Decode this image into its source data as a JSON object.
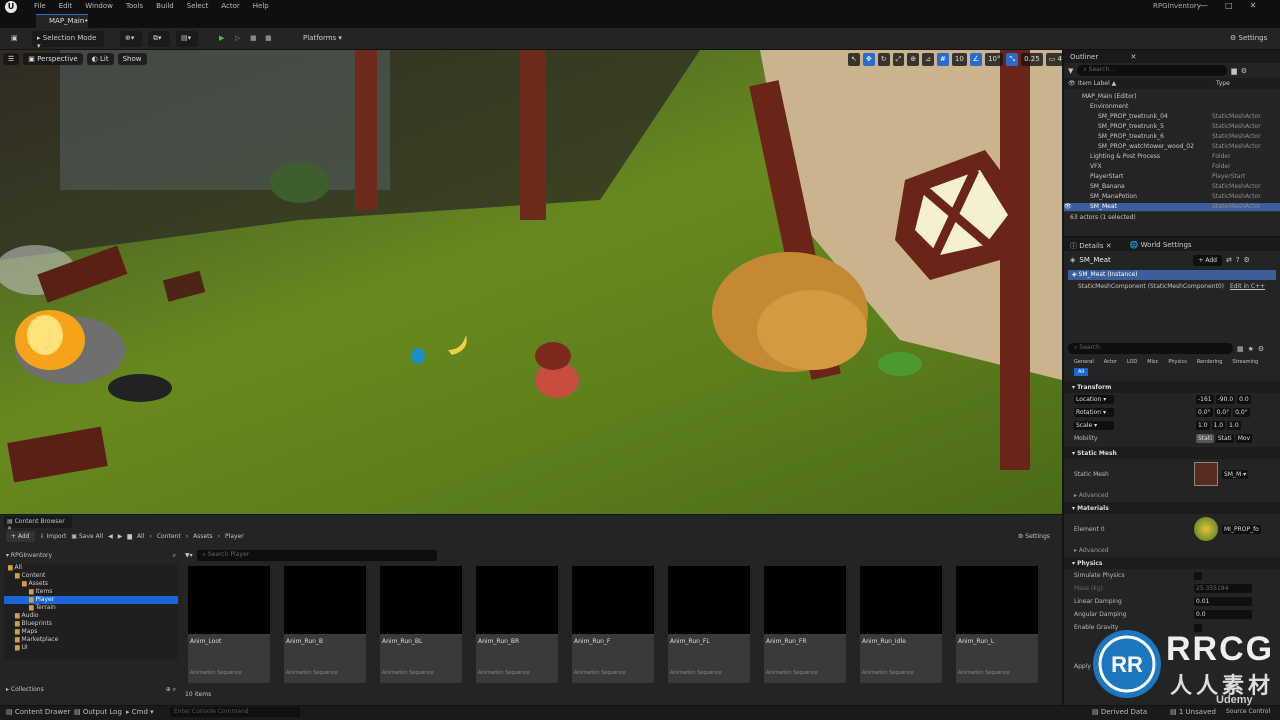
{
  "app": {
    "logo": "U",
    "menu": [
      "File",
      "Edit",
      "Window",
      "Tools",
      "Build",
      "Select",
      "Actor",
      "Help"
    ],
    "project_name": "RPGInventory",
    "window_controls": [
      "—",
      "□",
      "✕"
    ]
  },
  "tab": {
    "label": "MAP_Main•"
  },
  "toolbar": {
    "selection_mode": "Selection Mode",
    "platforms": "Platforms",
    "settings": "Settings"
  },
  "viewport": {
    "perspective": "Perspective",
    "lit": "Lit",
    "show": "Show",
    "grid_snap": "10",
    "rot_snap": "10°",
    "scale_snap": "0.25",
    "camera_speed": "4"
  },
  "outliner": {
    "title": "Outliner",
    "search_placeholder": "Search...",
    "col_label": "Item Label ▲",
    "col_type": "Type",
    "rows": [
      {
        "name": "MAP_Main (Editor)",
        "type": "",
        "indent": 1
      },
      {
        "name": "Environment",
        "type": "",
        "indent": 2
      },
      {
        "name": "SM_PROP_treetrunk_04",
        "type": "StaticMeshActor",
        "indent": 3
      },
      {
        "name": "SM_PROP_treetrunk_5",
        "type": "StaticMeshActor",
        "indent": 3
      },
      {
        "name": "SM_PROP_treetrunk_6",
        "type": "StaticMeshActor",
        "indent": 3
      },
      {
        "name": "SM_PROP_watchtower_wood_02",
        "type": "StaticMeshActor",
        "indent": 3
      },
      {
        "name": "Lighting & Post Process",
        "type": "Folder",
        "indent": 2
      },
      {
        "name": "VFX",
        "type": "Folder",
        "indent": 2
      },
      {
        "name": "PlayerStart",
        "type": "PlayerStart",
        "indent": 2
      },
      {
        "name": "SM_Banana",
        "type": "StaticMeshActor",
        "indent": 2
      },
      {
        "name": "SM_ManaPotion",
        "type": "StaticMeshActor",
        "indent": 2
      },
      {
        "name": "SM_Meat",
        "type": "StaticMeshActor",
        "indent": 2,
        "selected": true
      }
    ],
    "footer": "63 actors (1 selected)"
  },
  "details": {
    "tab_details": "Details",
    "tab_world": "World Settings",
    "actor": "SM_Meat",
    "add": "+ Add",
    "instance": "SM_Meat (Instance)",
    "component": "StaticMeshComponent (StaticMeshComponent0)",
    "edit_cpp": "Edit in C++",
    "search_placeholder": "Search",
    "filters": [
      "General",
      "Actor",
      "LOD",
      "Misc",
      "Physics",
      "Rendering",
      "Streaming",
      "All"
    ],
    "transform": "Transform",
    "location": "Location",
    "rotation": "Rotation",
    "scale": "Scale",
    "loc": [
      "-161",
      "-90.0",
      "0.0"
    ],
    "rot": [
      "0.0°",
      "0.0°",
      "0.0°"
    ],
    "scl": [
      "1.0",
      "1.0",
      "1.0"
    ],
    "mobility": "Mobility",
    "mob_opts": [
      "Stati",
      "Stati",
      "Mov"
    ],
    "static_mesh_sec": "Static Mesh",
    "static_mesh": "Static Mesh",
    "mesh_value": "SM_M ▾",
    "advanced": "Advanced",
    "materials": "Materials",
    "element0": "Element 0",
    "material_value": "MI_PROP_fo",
    "physics": "Physics",
    "sim_physics": "Simulate Physics",
    "mass": "Mass (kg)",
    "mass_val": "25.355194",
    "lin_damp": "Linear Damping",
    "lin_val": "0.01",
    "ang_damp": "Angular Damping",
    "ang_val": "0.0",
    "enable_grav": "Enable Gravity",
    "apply": "Apply"
  },
  "content_browser": {
    "tab": "Content Browser",
    "add": "+ Add",
    "import": "Import",
    "save_all": "Save All",
    "path": [
      "All",
      "Content",
      "Assets",
      "Player"
    ],
    "settings": "Settings",
    "project": "RPGInventory",
    "search_placeholder": "Search Player",
    "tree": [
      "All",
      "Content",
      "Assets",
      "Items",
      "Player",
      "Terrain",
      "Audio",
      "Blueprints",
      "Maps",
      "Marketplace",
      "UI"
    ],
    "collections": "Collections",
    "count": "10 items",
    "assets": [
      {
        "name": "Anim_Loot",
        "type": "Animation Sequence"
      },
      {
        "name": "Anim_Run_B",
        "type": "Animation Sequence"
      },
      {
        "name": "Anim_Run_BL",
        "type": "Animation Sequence"
      },
      {
        "name": "Anim_Run_BR",
        "type": "Animation Sequence"
      },
      {
        "name": "Anim_Run_F",
        "type": "Animation Sequence"
      },
      {
        "name": "Anim_Run_FL",
        "type": "Animation Sequence"
      },
      {
        "name": "Anim_Run_FR",
        "type": "Animation Sequence"
      },
      {
        "name": "Anim_Run_Idle",
        "type": "Animation Sequence"
      },
      {
        "name": "Anim_Run_L",
        "type": "Animation Sequence"
      }
    ]
  },
  "status": {
    "drawer": "Content Drawer",
    "output": "Output Log",
    "cmd": "Cmd ▾",
    "console_placeholder": "Enter Console Command",
    "derived": "Derived Data",
    "unsaved": "1 Unsaved",
    "source": "Source Control"
  },
  "watermark": {
    "brand": "RRCG",
    "sub": "人人素材",
    "udemy": "Udemy"
  }
}
